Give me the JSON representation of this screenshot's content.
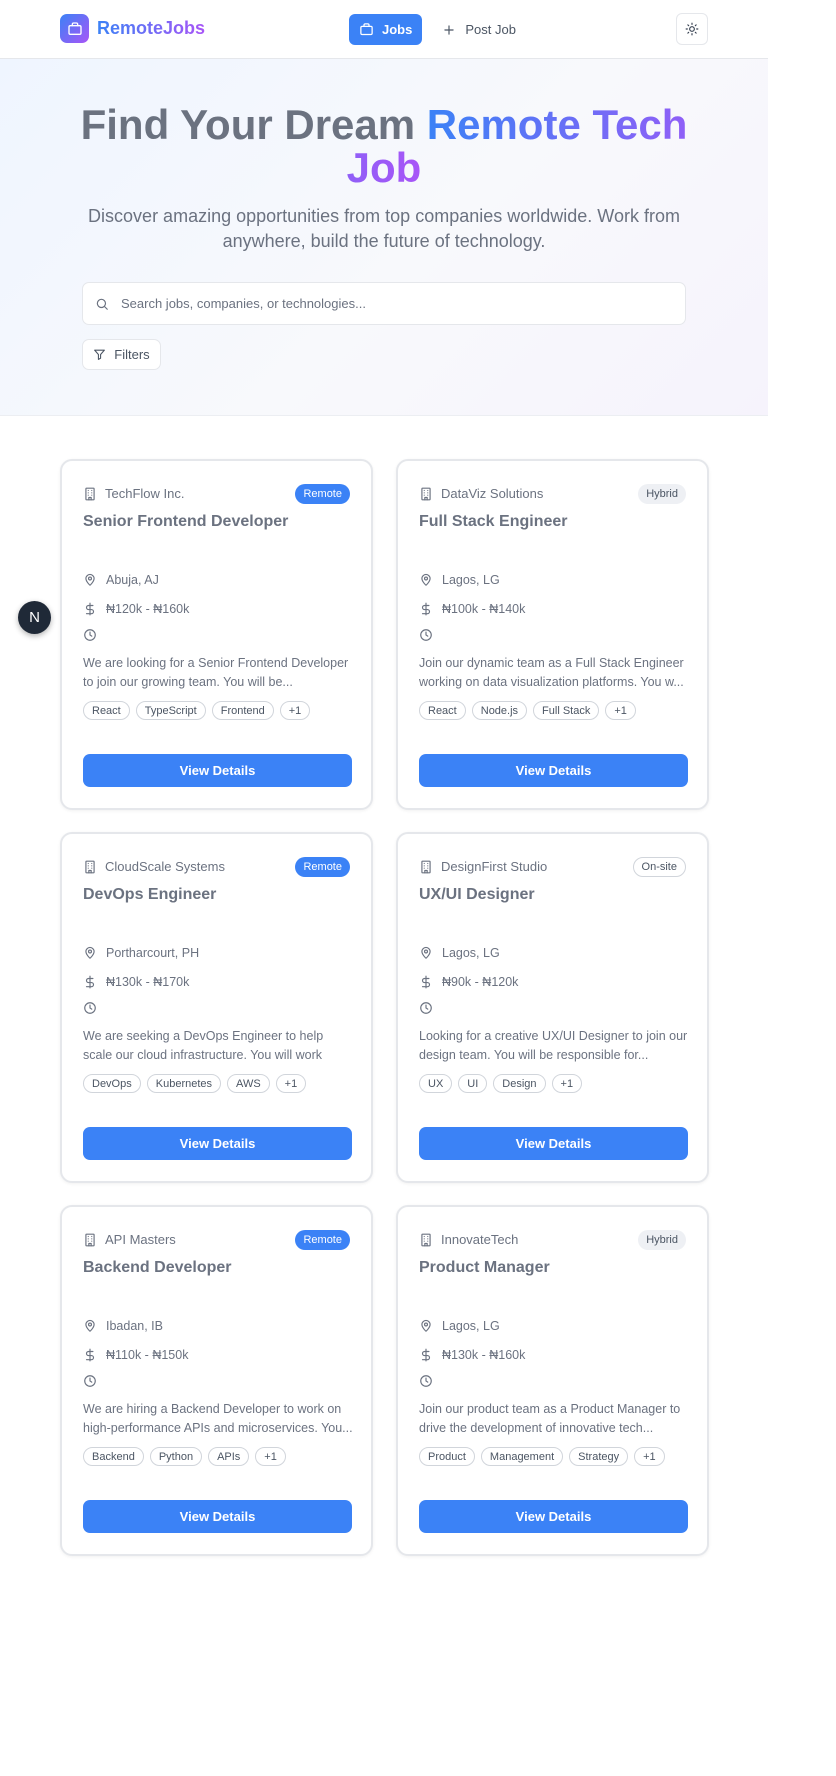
{
  "header": {
    "logo_text": "RemoteJobs",
    "nav_jobs": "Jobs",
    "nav_post_job": "Post Job"
  },
  "hero": {
    "title_plain": "Find Your Dream ",
    "title_highlight": "Remote Tech Job",
    "subtitle": "Discover amazing opportunities from top companies worldwide. Work from anywhere, build the future of technology.",
    "search_placeholder": "Search jobs, companies, or technologies...",
    "filters_label": "Filters"
  },
  "floating_badge": "N",
  "colors": {
    "primary": "#3b82f6",
    "accent": "#a855f7"
  },
  "jobs": [
    {
      "company": "TechFlow Inc.",
      "badge": "Remote",
      "badge_type": "remote",
      "title": "Senior Frontend Developer",
      "location": "Abuja, AJ",
      "salary": "₦120k - ₦160k",
      "description": "We are looking for a Senior Frontend Developer to join our growing team. You will be...",
      "tags": [
        "React",
        "TypeScript",
        "Frontend",
        "+1"
      ],
      "button": "View Details"
    },
    {
      "company": "DataViz Solutions",
      "badge": "Hybrid",
      "badge_type": "hybrid",
      "title": "Full Stack Engineer",
      "location": "Lagos, LG",
      "salary": "₦100k - ₦140k",
      "description": "Join our dynamic team as a Full Stack Engineer working on data visualization platforms. You w...",
      "tags": [
        "React",
        "Node.js",
        "Full Stack",
        "+1"
      ],
      "button": "View Details"
    },
    {
      "company": "CloudScale Systems",
      "badge": "Remote",
      "badge_type": "remote",
      "title": "DevOps Engineer",
      "location": "Portharcourt, PH",
      "salary": "₦130k - ₦170k",
      "description": "We are seeking a DevOps Engineer to help scale our cloud infrastructure. You will work with...",
      "tags": [
        "DevOps",
        "Kubernetes",
        "AWS",
        "+1"
      ],
      "button": "View Details"
    },
    {
      "company": "DesignFirst Studio",
      "badge": "On-site",
      "badge_type": "onsite",
      "title": "UX/UI Designer",
      "location": "Lagos, LG",
      "salary": "₦90k - ₦120k",
      "description": "Looking for a creative UX/UI Designer to join our design team. You will be responsible for...",
      "tags": [
        "UX",
        "UI",
        "Design",
        "+1"
      ],
      "button": "View Details"
    },
    {
      "company": "API Masters",
      "badge": "Remote",
      "badge_type": "remote",
      "title": "Backend Developer",
      "location": "Ibadan, IB",
      "salary": "₦110k - ₦150k",
      "description": "We are hiring a Backend Developer to work on high-performance APIs and microservices. You...",
      "tags": [
        "Backend",
        "Python",
        "APIs",
        "+1"
      ],
      "button": "View Details"
    },
    {
      "company": "InnovateTech",
      "badge": "Hybrid",
      "badge_type": "hybrid",
      "title": "Product Manager",
      "location": "Lagos, LG",
      "salary": "₦130k - ₦160k",
      "description": "Join our product team as a Product Manager to drive the development of innovative tech...",
      "tags": [
        "Product",
        "Management",
        "Strategy",
        "+1"
      ],
      "button": "View Details"
    }
  ]
}
